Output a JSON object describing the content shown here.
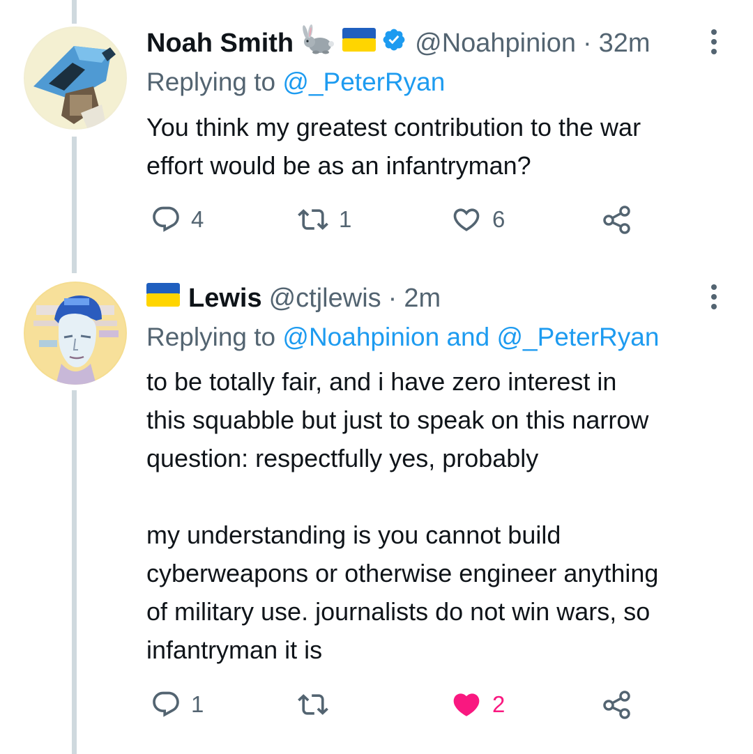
{
  "tweets": [
    {
      "display_name": "Noah Smith",
      "name_emojis": [
        "rabbit-emoji",
        "ukraine-flag-emoji"
      ],
      "verified": true,
      "handle": "@Noahpinion",
      "separator": "·",
      "time": "32m",
      "replying_prefix": "Replying to",
      "replying_mentions": [
        "@_PeterRyan"
      ],
      "replying_joiner": "",
      "text": "You think my greatest contribution to the war\neffort would be as an infantryman?",
      "actions": {
        "replies": "4",
        "retweets": "1",
        "likes": "6",
        "liked": false
      }
    },
    {
      "display_name": "Lewis",
      "name_emojis": [
        "ukraine-flag-emoji"
      ],
      "verified": false,
      "handle": "@ctjlewis",
      "separator": "·",
      "time": "2m",
      "replying_prefix": "Replying to",
      "replying_mentions": [
        "@Noahpinion",
        "@_PeterRyan"
      ],
      "replying_joiner": "and",
      "text": "to be totally fair, and i have zero interest in\nthis squabble but just to speak on this narrow\nquestion: respectfully yes, probably\n\nmy understanding is you cannot build\ncyberweapons or otherwise engineer anything\nof military use. journalists do not win wars, so\ninfantryman it is",
      "actions": {
        "replies": "1",
        "retweets": "",
        "likes": "2",
        "liked": true
      }
    }
  ],
  "colors": {
    "text_primary": "#0f1419",
    "text_secondary": "#536471",
    "link": "#1d9bf0",
    "like_active": "#f91880",
    "thread_line": "#cfd9de",
    "verified_badge": "#1d9bf0"
  }
}
